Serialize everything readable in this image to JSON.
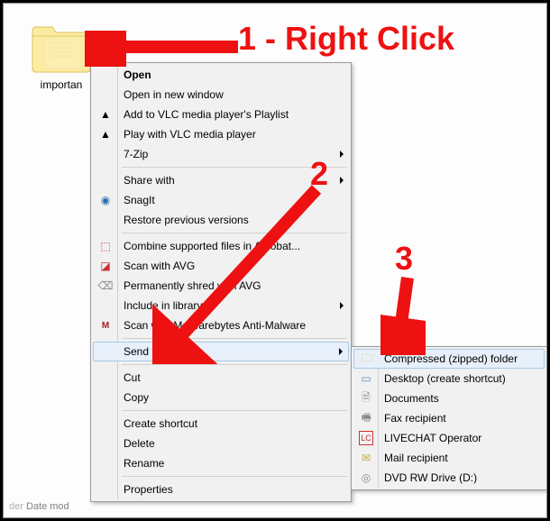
{
  "folder": {
    "label": "importan"
  },
  "statusbar": {
    "date_label": "Date mod"
  },
  "annotations": {
    "a1": "1 - Right Click",
    "a2": "2",
    "a3": "3"
  },
  "menu": {
    "open": "Open",
    "open_new": "Open in new window",
    "add_vlc_playlist": "Add to VLC media player's Playlist",
    "play_vlc": "Play with VLC media player",
    "seven_zip": "7-Zip",
    "share_with": "Share with",
    "snagit": "SnagIt",
    "restore_prev": "Restore previous versions",
    "combine_acrobat": "Combine supported files in Acrobat...",
    "scan_avg": "Scan with AVG",
    "perm_shred": "Permanently shred with AVG",
    "include_lib": "Include in library",
    "scan_mbam": "Scan with Malwarebytes Anti-Malware",
    "send_to": "Send to",
    "cut": "Cut",
    "copy": "Copy",
    "create_shortcut": "Create shortcut",
    "delete": "Delete",
    "rename": "Rename",
    "properties": "Properties"
  },
  "submenu": {
    "zipped": "Compressed (zipped) folder",
    "desktop": "Desktop (create shortcut)",
    "documents": "Documents",
    "fax": "Fax recipient",
    "livechat": "LIVECHAT Operator",
    "mail": "Mail recipient",
    "dvd": "DVD RW Drive (D:)"
  }
}
